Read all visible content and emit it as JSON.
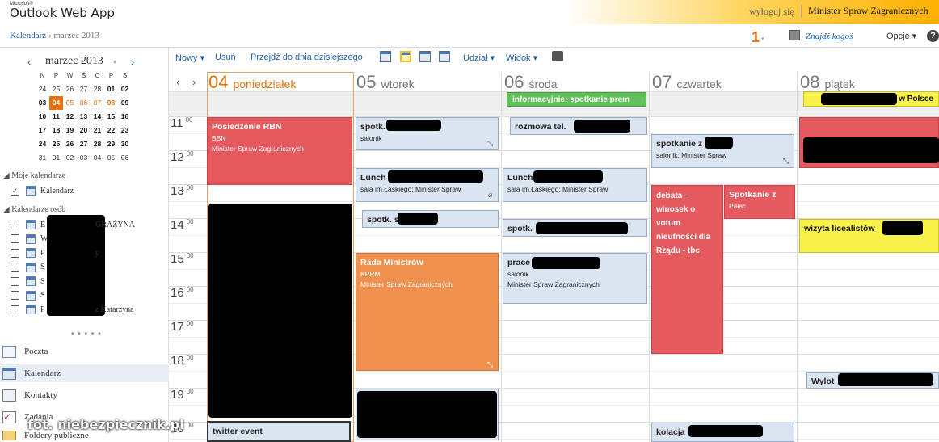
{
  "header": {
    "ms_label": "Microsoft®",
    "app_title": "Outlook Web App",
    "logout": "wyloguj się",
    "user": "Minister Spraw Zagranicznych"
  },
  "breadcrumb": {
    "root": "Kalendarz",
    "sep": " › ",
    "current": "marzec 2013"
  },
  "toolbar_top": {
    "reminder_count": "1",
    "find_label": "Znajdź kogoś",
    "options": "Opcje",
    "help": "?"
  },
  "minical": {
    "title": "marzec 2013",
    "weekdays": [
      "N",
      "P",
      "W",
      "Ś",
      "C",
      "P",
      "S"
    ],
    "weeks": [
      [
        "24",
        "25",
        "26",
        "27",
        "28",
        "01",
        "02"
      ],
      [
        "03",
        "04",
        "05",
        "06",
        "07",
        "08",
        "09"
      ],
      [
        "10",
        "11",
        "12",
        "13",
        "14",
        "15",
        "16"
      ],
      [
        "17",
        "18",
        "19",
        "20",
        "21",
        "22",
        "23"
      ],
      [
        "24",
        "25",
        "26",
        "27",
        "28",
        "29",
        "30"
      ],
      [
        "31",
        "01",
        "02",
        "03",
        "04",
        "05",
        "06"
      ]
    ]
  },
  "sections": {
    "my_calendars": "Moje kalendarze",
    "my_calendar_item": "Kalendarz",
    "others": "Kalendarze osób",
    "others_items": [
      "E",
      "W",
      "P",
      "S",
      "S",
      "S",
      "P"
    ],
    "others_suffix": [
      "GRAŻYNA",
      "",
      "y",
      "",
      "",
      "",
      "z Katarzyna"
    ]
  },
  "nav": {
    "mail": "Poczta",
    "calendar": "Kalendarz",
    "contacts": "Kontakty",
    "tasks": "Zadania",
    "public": "Foldery publiczne"
  },
  "commands": {
    "new": "Nowy",
    "delete": "Usuń",
    "today": "Przejdź do dnia dzisiejszego",
    "share": "Udział",
    "view": "Widok"
  },
  "days": [
    {
      "num": "04",
      "name": "poniedziałek"
    },
    {
      "num": "05",
      "name": "wtorek"
    },
    {
      "num": "06",
      "name": "środa"
    },
    {
      "num": "07",
      "name": "czwartek"
    },
    {
      "num": "08",
      "name": "piątek"
    }
  ],
  "hours": [
    "11",
    "12",
    "13",
    "14",
    "15",
    "16",
    "17",
    "18",
    "19",
    "20"
  ],
  "minutes": "00",
  "allday": {
    "wed": "informacyjnie: spotkanie prem",
    "fri": "w Polsce"
  },
  "events": {
    "rbn": {
      "title": "Posiedzenie RBN",
      "l1": "BBN",
      "l2": "Minister Spraw Zagranicznych"
    },
    "twitter": {
      "title": "twitter event"
    },
    "spotk_tue": {
      "title": "spotk.",
      "l1": "salonik"
    },
    "lunch_tue": {
      "title": "Lunch",
      "l1": "sala im.Łaskiego; Minister Spraw"
    },
    "spotk_tue2": {
      "title": "spotk. s"
    },
    "rada": {
      "title": "Rada Ministrów",
      "l1": "KPRM",
      "l2": "Minister Spraw Zagranicznych"
    },
    "rozmowa": {
      "title": "rozmowa tel."
    },
    "lunch_wed": {
      "title": "Lunch",
      "l1": "sala im.Łaskiego; Minister Spraw"
    },
    "spotk_wed": {
      "title": "spotk."
    },
    "prace": {
      "title": "prace",
      "l1": "salonik",
      "l2": "Minister Spraw Zagranicznych"
    },
    "spotkanie_thu": {
      "title": "spotkanie z",
      "l1": "salonik; Minister Spraw"
    },
    "debata": {
      "title": "debata - winosek o votum nieufności dla Rządu - tbc"
    },
    "spotkanie_palac": {
      "title": "Spotkanie z",
      "l1": "Pałac"
    },
    "kolacja": {
      "title": "kolacja"
    },
    "wizyta": {
      "title": "wizyta licealistów"
    },
    "wylot": {
      "title": "Wylot"
    }
  },
  "watermark": "fot. niebezpiecznik.pl",
  "colors": {
    "accent": "#e8700a",
    "link": "#1f5fa8",
    "red_event": "#e45a5f",
    "orange_event": "#f0904f",
    "blue_event": "#dbe5f1",
    "yellow_event": "#f8f24a",
    "green_event": "#62c15a"
  }
}
